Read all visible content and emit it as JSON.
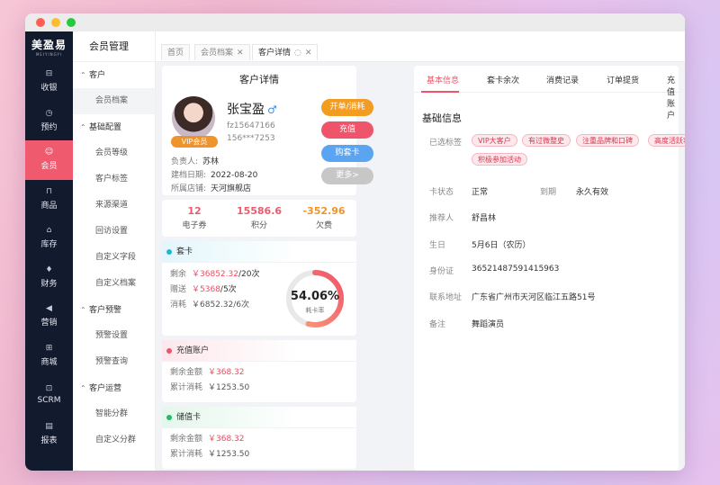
{
  "brand": {
    "logo_main": "美盈易",
    "logo_sub": "MEIYINGYI"
  },
  "nav": [
    {
      "label": "收银",
      "icon": "cashier-icon",
      "glyph": "⊟"
    },
    {
      "label": "预约",
      "icon": "clock-icon",
      "glyph": "◷"
    },
    {
      "label": "会员",
      "icon": "member-icon",
      "glyph": "☺"
    },
    {
      "label": "商品",
      "icon": "bag-icon",
      "glyph": "⊓"
    },
    {
      "label": "库存",
      "icon": "home-icon",
      "glyph": "⌂"
    },
    {
      "label": "财务",
      "icon": "finance-icon",
      "glyph": "♦"
    },
    {
      "label": "营销",
      "icon": "megaphone-icon",
      "glyph": "◀"
    },
    {
      "label": "商城",
      "icon": "store-icon",
      "glyph": "⊞"
    },
    {
      "label": "SCRM",
      "icon": "scrm-icon",
      "glyph": "⊡"
    },
    {
      "label": "报表",
      "icon": "report-icon",
      "glyph": "▤"
    }
  ],
  "submenu": {
    "title": "会员管理",
    "groups": [
      {
        "label": "客户",
        "items": [
          "会员档案"
        ]
      },
      {
        "label": "基础配置",
        "items": [
          "会员等级",
          "客户标签",
          "来源渠道",
          "回访设置",
          "自定义字段",
          "自定义档案"
        ]
      },
      {
        "label": "客户预警",
        "items": [
          "预警设置",
          "预警查询"
        ]
      },
      {
        "label": "客户运营",
        "items": [
          "智能分群",
          "自定义分群"
        ]
      }
    ]
  },
  "tabs": [
    {
      "label": "首页"
    },
    {
      "label": "会员档案",
      "close": "✕"
    },
    {
      "label": "客户详情",
      "refresh": "◌",
      "close": "✕"
    }
  ],
  "profile": {
    "card_title": "客户详情",
    "name": "张宝盈",
    "gender": "♂",
    "vip": "VIP会员",
    "id": "fz15647166",
    "phone": "156***7253",
    "owner_label": "负责人:",
    "owner": "苏林",
    "date_label": "建档日期:",
    "date": "2022-08-20",
    "store_label": "所属店铺:",
    "store": "天河旗舰店",
    "buttons": {
      "open": "开单/消耗",
      "recharge": "充值",
      "buy": "购套卡",
      "more": "更多>"
    }
  },
  "stats": [
    {
      "value": "12",
      "label": "电子券",
      "color": "#f05a6e"
    },
    {
      "value": "15586.6",
      "label": "积分",
      "color": "#f05a6e"
    },
    {
      "value": "-352.96",
      "label": "欠费",
      "color": "#f0932b"
    }
  ],
  "package_card": {
    "title": "套卡",
    "remain_label": "剩余",
    "remain_amount": "￥36852.32",
    "remain_count": "/20次",
    "gift_label": "赠送",
    "gift_amount": "￥5368",
    "gift_count": "/5次",
    "used_label": "消耗",
    "used_value": "￥6852.32/6次",
    "rate_text": "54.06%",
    "rate_label": "耗卡率",
    "rate": 54.06
  },
  "recharge_account": {
    "title": "充值账户",
    "remain_label": "剩余金额",
    "remain": "￥368.32",
    "total_label": "累计消耗",
    "total": "￥1253.50"
  },
  "stored_card": {
    "title": "储值卡",
    "remain_label": "剩余金额",
    "remain": "￥368.32",
    "total_label": "累计消耗",
    "total": "￥1253.50"
  },
  "detail_tabs": [
    "基本信息",
    "套卡余次",
    "消费记录",
    "订单提货",
    "充值账户"
  ],
  "basic": {
    "title": "基础信息",
    "tags_label": "已选标签",
    "tags": [
      "VIP大客户",
      "有过微整史",
      "注重品牌和口碑",
      "高度活跃客户",
      "积极参加活动"
    ],
    "card_status_label": "卡状态",
    "card_status": "正常",
    "expire_label": "到期",
    "expire": "永久有效",
    "referrer_label": "推荐人",
    "referrer": "舒昌林",
    "birthday_label": "生日",
    "birthday": "5月6日（农历）",
    "idcard_label": "身份证",
    "idcard": "36521487591415963",
    "address_label": "联系地址",
    "address": "广东省广州市天河区临江五路51号",
    "remark_label": "备注",
    "remark": "舞蹈演员"
  }
}
